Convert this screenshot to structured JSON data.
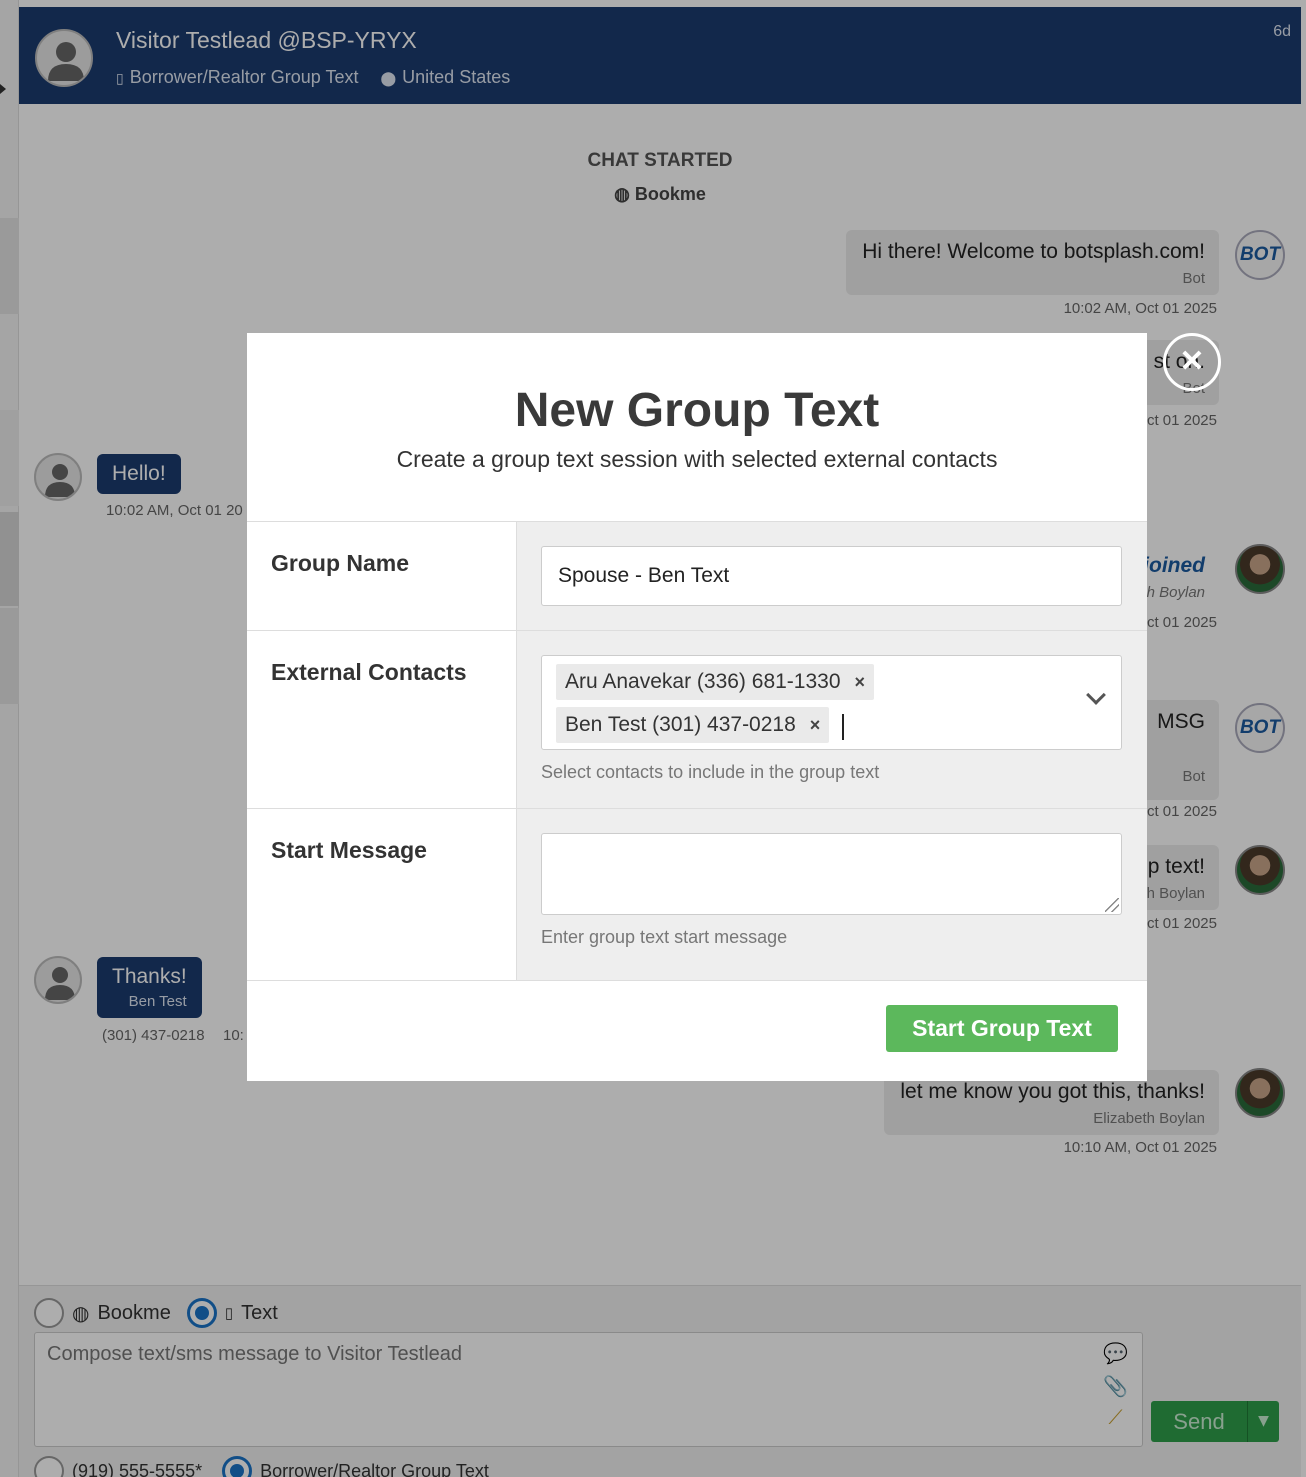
{
  "header": {
    "visitor_name": "Visitor Testlead @BSP-YRYX",
    "channel": "Borrower/Realtor Group Text",
    "location": "United States",
    "age": "6d"
  },
  "chat": {
    "started_label": "CHAT STARTED",
    "source": "Bookme",
    "messages": [
      {
        "text": "Hi there! Welcome to botsplash.com!",
        "who": "Bot",
        "time": "10:02 AM, Oct 01 2025"
      },
      {
        "text": "st on.",
        "who": "Bot",
        "time": "ct 01 2025"
      },
      {
        "text": "Hello!",
        "time": "10:02 AM, Oct 01 20"
      },
      {
        "text": "joined",
        "who": "h Boylan",
        "time": "ct 01 2025"
      },
      {
        "text": "MSG",
        "who": "Bot",
        "time": "ct 01 2025"
      },
      {
        "text": "p text!",
        "who": "h Boylan",
        "time": "ct 01 2025"
      },
      {
        "text": "Thanks!",
        "who": "Ben Test",
        "phone": "(301) 437-0218",
        "time": "10:"
      },
      {
        "text": "let me know you got this, thanks!",
        "who": "Elizabeth Boylan",
        "time": "10:10 AM, Oct 01 2025"
      }
    ],
    "bot_badge": "BOT"
  },
  "composer": {
    "channel_bookme": "Bookme",
    "channel_text": "Text",
    "placeholder": "Compose text/sms message to Visitor Testlead",
    "send_label": "Send",
    "phone_option": "(919) 555-5555*",
    "group_option": "Borrower/Realtor Group Text"
  },
  "modal": {
    "title": "New Group Text",
    "subtitle": "Create a group text session with selected external contacts",
    "group_name_label": "Group Name",
    "group_name_value": "Spouse - Ben Text",
    "contacts_label": "External Contacts",
    "contacts": [
      "Aru Anavekar (336) 681-1330",
      "Ben Test (301) 437-0218"
    ],
    "contacts_help": "Select contacts to include in the group text",
    "start_message_label": "Start Message",
    "start_message_value": "",
    "start_message_help": "Enter group text start message",
    "submit_label": "Start Group Text",
    "close_glyph": "✕",
    "remove_glyph": "×"
  },
  "colors": {
    "header_bg": "#1b3b6f",
    "incoming_bubble": "#1b3b6f",
    "submit_bg": "#5cb85c",
    "send_bg": "#2e9e4a",
    "radio_active": "#1a73c8"
  }
}
